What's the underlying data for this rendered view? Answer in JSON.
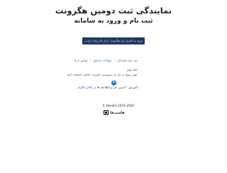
{
  "header": {
    "title": "نمایندگی ثبت دومین هگزونت",
    "subtitle": "ثبت نام و ورود به سامانه"
  },
  "cta": {
    "label": "ورود به کنترل پنل هگزونت برای کاربران ایرانی"
  },
  "links": [
    {
      "label": "ثبت نام نمایندگی"
    },
    {
      "label": "سوالات متداول"
    },
    {
      "label": "تماس با ما"
    }
  ],
  "tips": {
    "title": "نکته مهم",
    "line": "جهت ورود به پنل از دسترسی اینترنت داخلی استفاده کنید",
    "note": "آموزش جامع پنل و تمامی امکانات در بخش راهنما"
  },
  "language": {
    "icon": "globe-icon",
    "text": "آموزش : آخرین خبر و اطلاعیه ها در",
    "link": "کانال تلگرام"
  },
  "footer": {
    "copyright": "© HexaFa 2015-2024",
    "brand": "هاست‌فا"
  }
}
